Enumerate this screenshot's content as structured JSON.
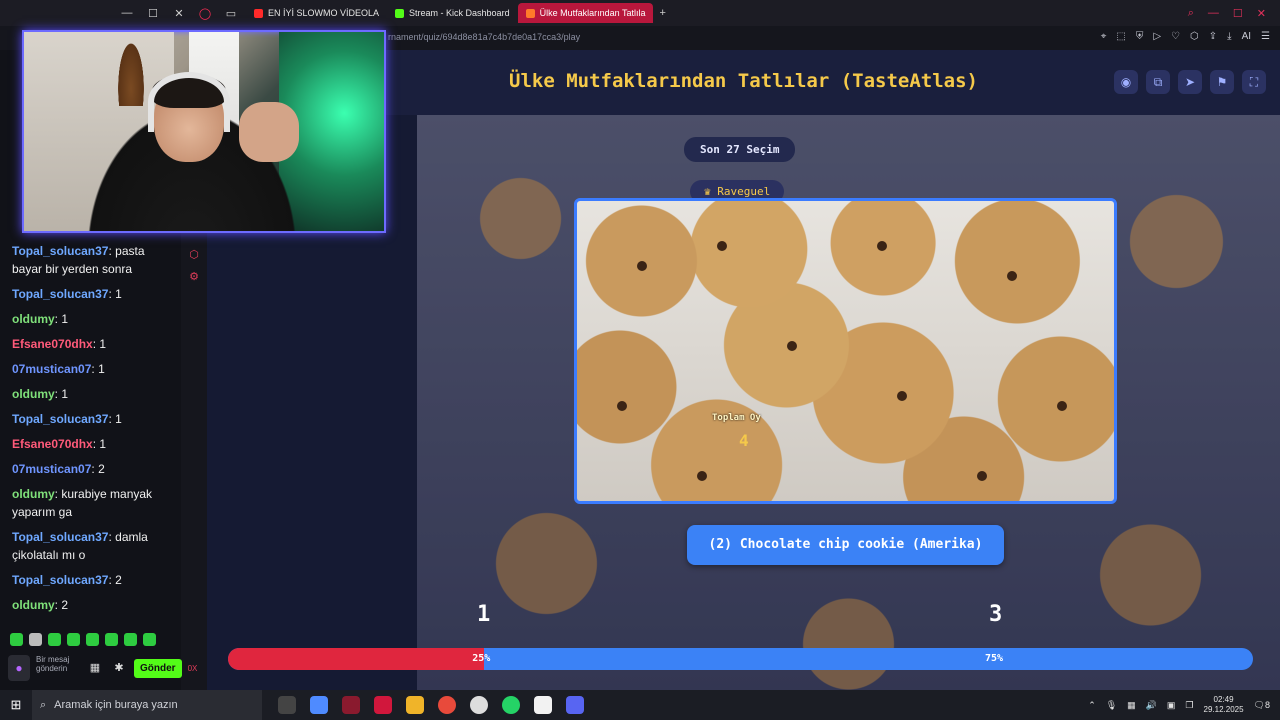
{
  "browser": {
    "tabs": [
      {
        "label": "EN İYİ SLOWMO VİDEOLA",
        "active": false,
        "fav_color": "#ff2a2a"
      },
      {
        "label": "Stream - Kick Dashboard",
        "active": false,
        "fav_color": "#53fc18"
      },
      {
        "label": "Ülke Mutfaklarından Tatlıla",
        "active": true,
        "fav_color": "#ff7a2a"
      }
    ],
    "new_tab": "+",
    "url": "rnament/quiz/694d8e81a7c4b7de0a17cca3/play"
  },
  "chat": {
    "messages": [
      {
        "user": "Topal_solucan37",
        "color": "u-topal",
        "text": "pasta bayar bir yerden sonra"
      },
      {
        "user": "Topal_solucan37",
        "color": "u-topal",
        "text": "1"
      },
      {
        "user": "oldumy",
        "color": "u-old",
        "text": "1"
      },
      {
        "user": "Efsane070dhx",
        "color": "u-efs",
        "text": "1"
      },
      {
        "user": "07mustican07",
        "color": "u-07",
        "text": "1"
      },
      {
        "user": "oldumy",
        "color": "u-old",
        "text": "1"
      },
      {
        "user": "Topal_solucan37",
        "color": "u-topal",
        "text": "1"
      },
      {
        "user": "Efsane070dhx",
        "color": "u-efs",
        "text": "1"
      },
      {
        "user": "07mustican07",
        "color": "u-07",
        "text": "2"
      },
      {
        "user": "oldumy",
        "color": "u-old",
        "text": "kurabiye manyak yaparım ga"
      },
      {
        "user": "Topal_solucan37",
        "color": "u-topal",
        "text": "damla çikolatalı mı o"
      },
      {
        "user": "Topal_solucan37",
        "color": "u-topal",
        "text": "2"
      },
      {
        "user": "oldumy",
        "color": "u-old",
        "text": "2"
      }
    ],
    "input_placeholder": "Bir mesaj gönderin",
    "send_label": "Gönder",
    "char_count": "0X"
  },
  "quiz": {
    "title": "Ülke Mutfaklarından Tatlılar (TasteAtlas)",
    "last_choice": "Son 27 Seçim",
    "user": "Raveguel",
    "card_total_label": "Toplam Oy",
    "card_total_value": "4",
    "answer": "(2) Chocolate chip cookie (Amerika)",
    "left_number": "1",
    "right_number": "3",
    "left_percent_label": "25%",
    "right_percent_label": "75%",
    "left_fraction": 0.25,
    "left_color": "#e0263e",
    "right_color": "#3b82f6",
    "header_icons": [
      "eye-icon",
      "share-icon",
      "send-icon",
      "flag-icon",
      "fullscreen-icon"
    ]
  },
  "taskbar": {
    "search_placeholder": "Aramak için buraya yazın",
    "time": "02:49",
    "date": "29.12.2025",
    "notif_count": "8"
  }
}
